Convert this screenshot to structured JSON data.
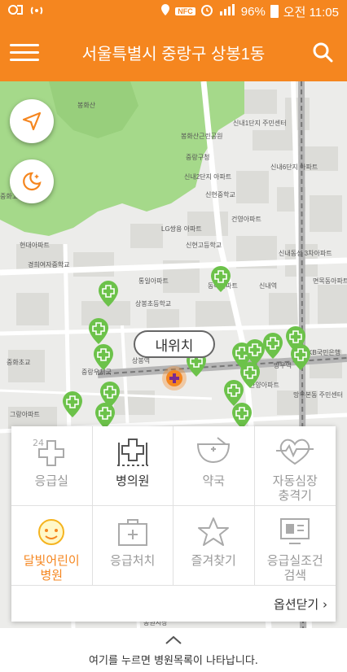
{
  "status_bar": {
    "battery": "96%",
    "time": "오전 11:05"
  },
  "header": {
    "title": "서울특별시 중랑구 상봉1동"
  },
  "map": {
    "my_location_label": "내위치",
    "labels": [
      {
        "text": "봉화산"
      },
      {
        "text": "봉화산근린공원"
      },
      {
        "text": "중랑구청"
      },
      {
        "text": "신내1단지 주민센터"
      },
      {
        "text": "신내2단지 아파트"
      },
      {
        "text": "신현중학교"
      },
      {
        "text": "신내6단지 아파트"
      },
      {
        "text": "신내동성 3차아파트"
      },
      {
        "text": "신내역"
      },
      {
        "text": "건영아파트"
      },
      {
        "text": "동아아파트"
      },
      {
        "text": "상봉초등학교"
      },
      {
        "text": "경희여자중학교"
      },
      {
        "text": "상봉역"
      },
      {
        "text": "망우역"
      },
      {
        "text": "KB국민은행"
      },
      {
        "text": "중화초교"
      },
      {
        "text": "현대아파트"
      },
      {
        "text": "통일아파트"
      },
      {
        "text": "LG쌍용 아파트"
      },
      {
        "text": "신현고등학교"
      },
      {
        "text": "중랑우체국"
      },
      {
        "text": "그랑아파트"
      },
      {
        "text": "동원시장"
      },
      {
        "text": "한양아파트"
      },
      {
        "text": "망우본동 주민센터"
      },
      {
        "text": "중화고교"
      },
      {
        "text": "면목동아파트"
      }
    ]
  },
  "menu": {
    "items": [
      {
        "label": "응급실",
        "icon": "emergency-24-icon"
      },
      {
        "label": "병의원",
        "icon": "hospital-icon"
      },
      {
        "label": "약국",
        "icon": "pharmacy-icon"
      },
      {
        "label": "자동심장\n충격기",
        "icon": "heart-defibrillator-icon"
      },
      {
        "label": "달빛어린이\n병원",
        "icon": "moonlight-child-icon"
      },
      {
        "label": "응급처치",
        "icon": "first-aid-kit-icon"
      },
      {
        "label": "즐겨찾기",
        "icon": "star-icon"
      },
      {
        "label": "응급실조건\n검색",
        "icon": "condition-search-icon"
      }
    ],
    "close_label": "옵션닫기 ›"
  },
  "bottom": {
    "hint": "여기를 누르면 병원목록이 나타납니다."
  },
  "colors": {
    "accent": "#f5861f",
    "pin": "#6cc24a",
    "park": "#a5d98a"
  }
}
